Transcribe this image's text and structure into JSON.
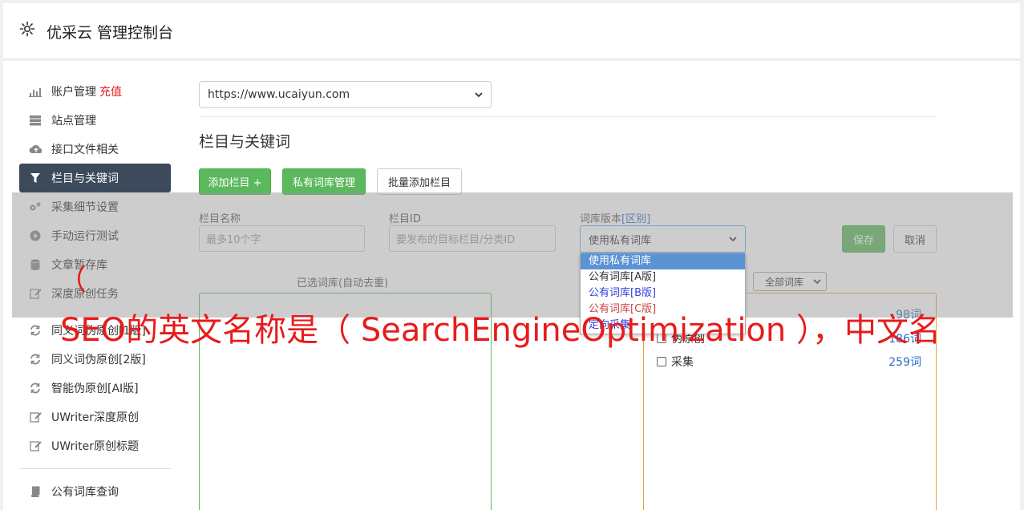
{
  "header": {
    "title": "优采云 管理控制台",
    "icon": "gear-icon"
  },
  "sidebar": {
    "items": [
      {
        "label": "账户管理",
        "extra": "充值",
        "icon": "bar-chart-icon"
      },
      {
        "label": "站点管理",
        "icon": "server-icon"
      },
      {
        "label": "接口文件相关",
        "icon": "cloud-upload-icon"
      },
      {
        "label": "栏目与关键词",
        "icon": "filter-icon",
        "active": true
      },
      {
        "label": "采集细节设置",
        "icon": "gears-icon"
      },
      {
        "label": "手动运行测试",
        "icon": "play-circle-icon"
      },
      {
        "label": "文章暂存库",
        "icon": "database-icon"
      },
      {
        "label": "深度原创任务",
        "icon": "edit-icon"
      },
      {
        "label": "同义词伪原创[1版]",
        "icon": "refresh-icon"
      },
      {
        "label": "同义词伪原创[2版]",
        "icon": "refresh-icon"
      },
      {
        "label": "智能伪原创[AI版]",
        "icon": "refresh-icon"
      },
      {
        "label": "UWriter深度原创",
        "icon": "edit-icon"
      },
      {
        "label": "UWriter原创标题",
        "icon": "edit-icon"
      },
      {
        "label": "公有词库查询",
        "icon": "book-icon"
      }
    ]
  },
  "main": {
    "site_select": "https://www.ucaiyun.com",
    "section_title": "栏目与关键词",
    "buttons": {
      "add_column": "添加栏目 +",
      "private_lib": "私有词库管理",
      "batch_add": "批量添加栏目"
    },
    "form": {
      "name_label": "栏目名称",
      "name_placeholder": "最多10个字",
      "id_label": "栏目ID",
      "id_placeholder": "要发布的目标栏目/分类ID",
      "lib_label": "词库版本",
      "lib_label_link": "[区别]",
      "lib_value": "使用私有词库",
      "save": "保存",
      "cancel": "取消"
    },
    "dropdown_options": [
      "使用私有词库",
      "公有词库[A版]",
      "公有词库[B版]",
      "公有词库[C版]",
      "定向采集"
    ],
    "selected_title": "已选词库(自动去重)",
    "all_lib_select": "全部词库",
    "libraries": [
      {
        "name": "",
        "count": "98词"
      },
      {
        "name": "伪原创",
        "count": "186词"
      },
      {
        "name": "采集",
        "count": "259词"
      }
    ]
  },
  "caption": {
    "open_paren": "（",
    "text": "SEO的英文名称是（ SearchEngineOptimization ），中文名"
  },
  "colors": {
    "accent_green": "#5cb85c",
    "active_nav": "#3c4a5c",
    "caption_red": "#e81b1b",
    "count_blue": "#2a6cc4"
  }
}
